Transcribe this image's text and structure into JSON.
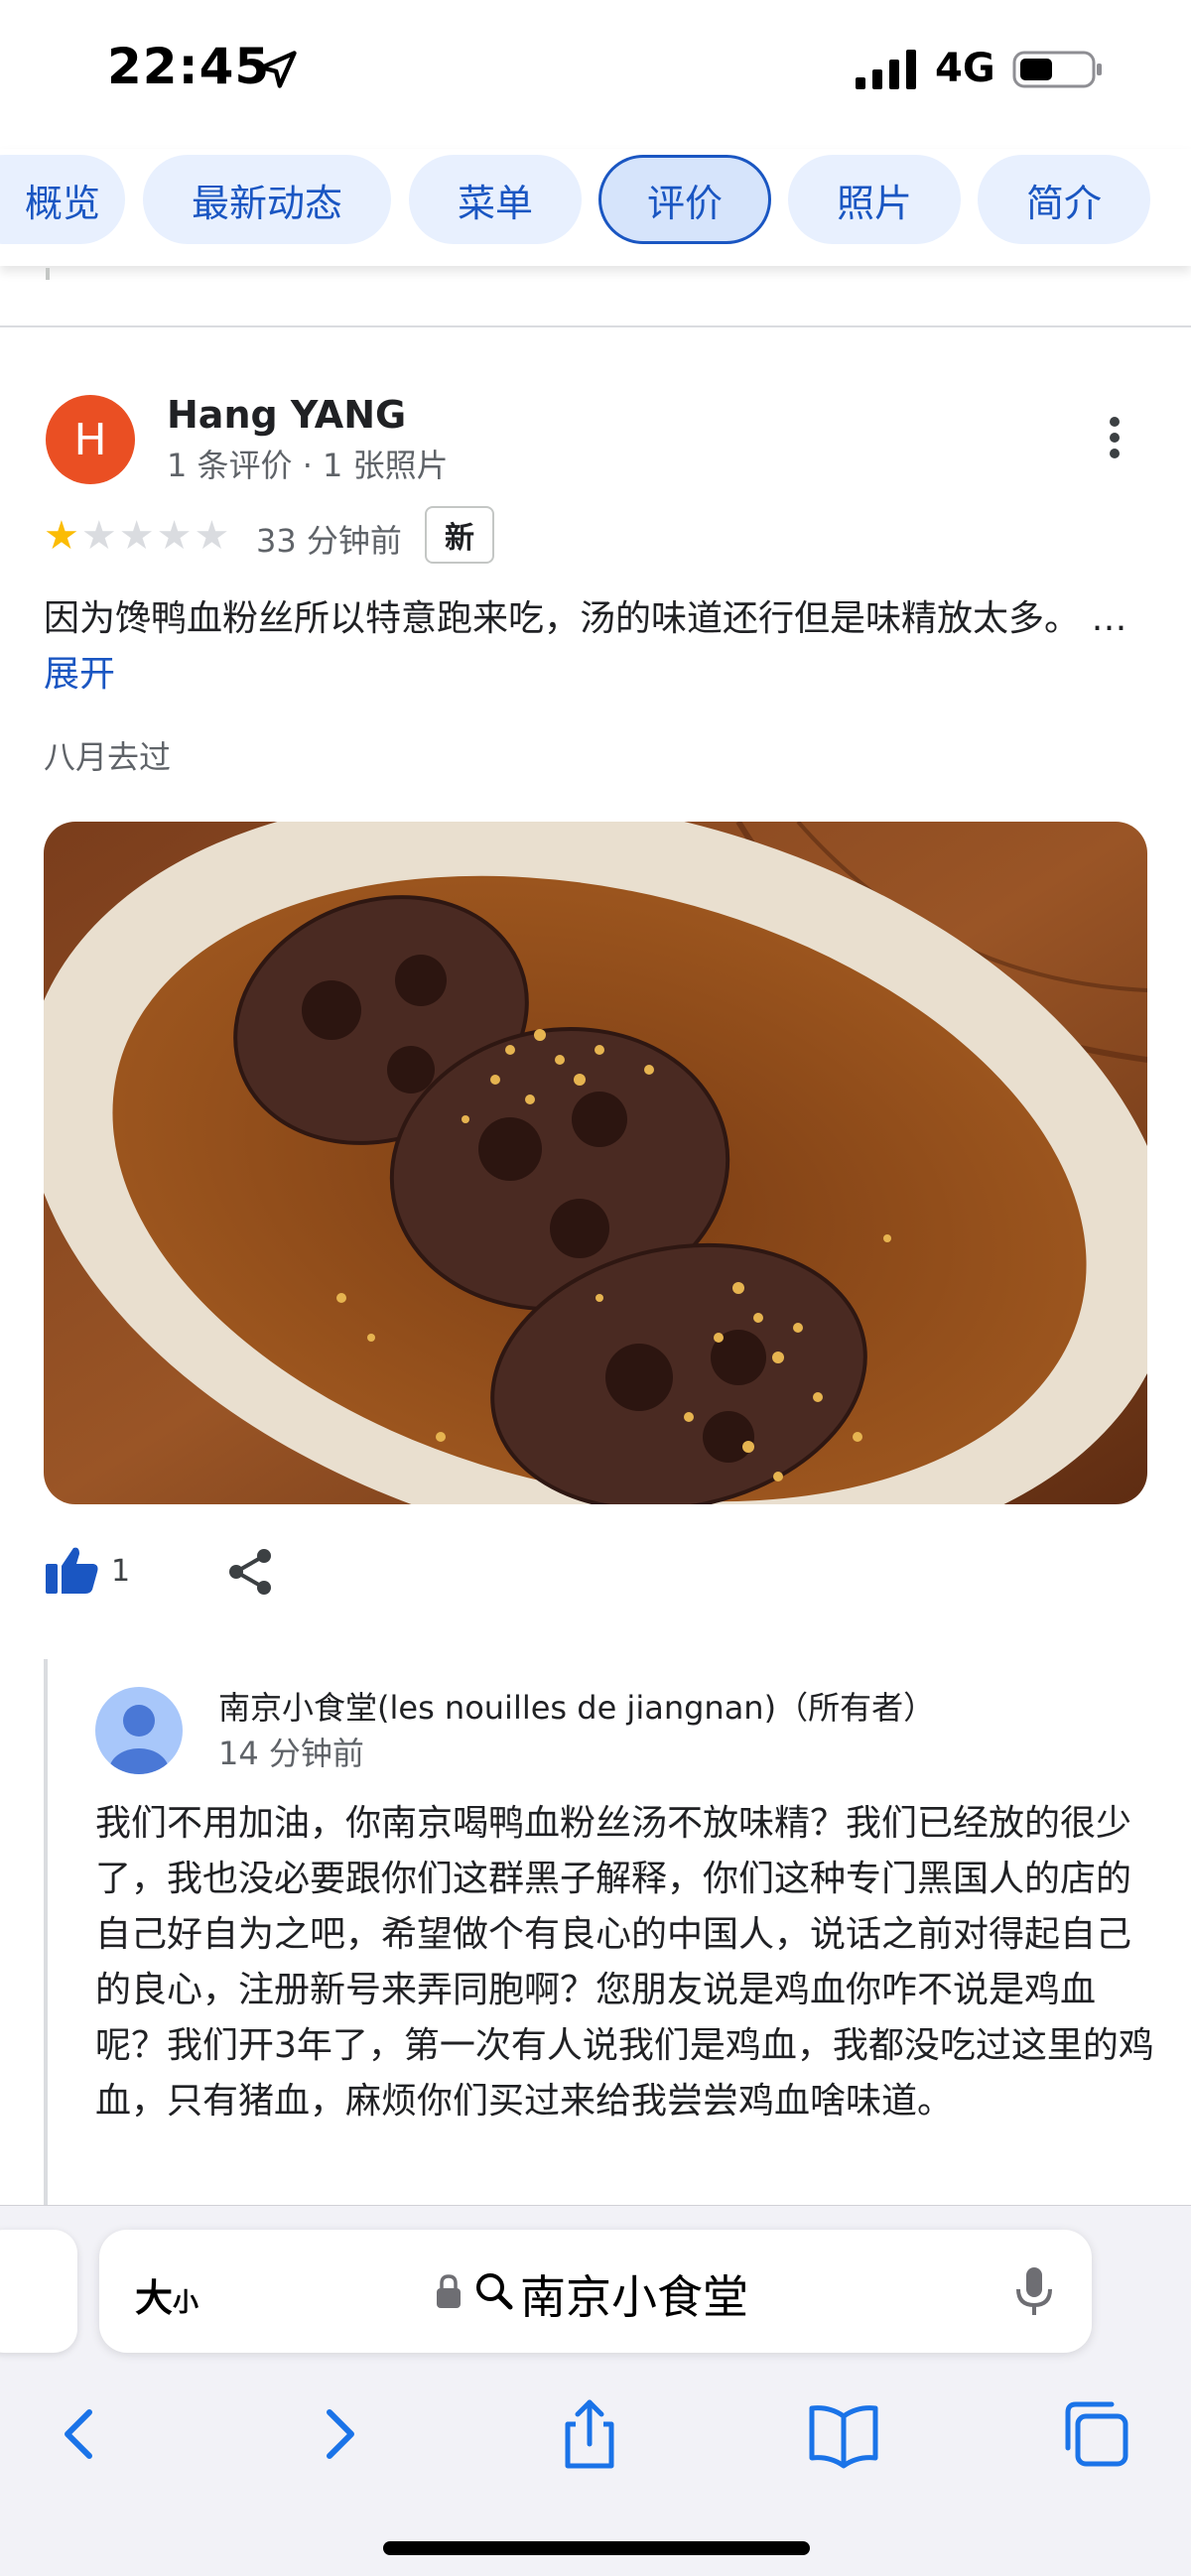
{
  "status_bar": {
    "time": "22:45",
    "network": "4G"
  },
  "tabs": [
    {
      "label": "概览"
    },
    {
      "label": "最新动态"
    },
    {
      "label": "菜单"
    },
    {
      "label": "评价",
      "active": true
    },
    {
      "label": "照片"
    },
    {
      "label": "简介"
    }
  ],
  "review": {
    "avatar_letter": "H",
    "avatar_color": "#ea4f23",
    "author": "Hang YANG",
    "meta": "1 条评价 · 1 张照片",
    "rating": 1,
    "rating_max": 5,
    "time_ago": "33 分钟前",
    "badge": "新",
    "text": "因为馋鸭血粉丝所以特意跑来吃，汤的味道还行但是味精放太多。 …",
    "expand_label": "展开",
    "visit_note": "八月去过",
    "photo_icon": "lotus-root-dish-photo",
    "likes": "1"
  },
  "owner_reply": {
    "name": "南京小食堂(les nouilles de jiangnan)（所有者）",
    "time_ago": "14 分钟前",
    "text": "我们不用加油，你南京喝鸭血粉丝汤不放味精？我们已经放的很少了，我也没必要跟你们这群黑子解释，你们这种专门黑国人的店的自己好自为之吧，希望做个有良心的中国人，说话之前对得起自己的良心，注册新号来弄同胞啊？您朋友说是鸡血你咋不说是鸡血呢？我们开3年了，第一次有人说我们是鸡血，我都没吃过这里的鸡血，只有猪血，麻烦你们买过来给我尝尝鸡血啥味道。"
  },
  "browser": {
    "text_size_label": "大",
    "text_size_small": "小",
    "url": "南京小食堂"
  },
  "colors": {
    "accent": "#1a56c2",
    "tab_bg": "#e8f0fe",
    "star": "#fbbc04"
  }
}
